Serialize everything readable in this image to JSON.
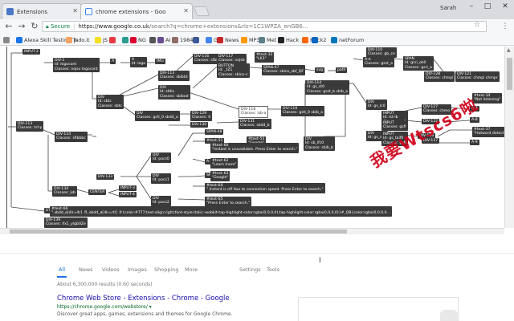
{
  "tabs": [
    {
      "title": "Extensions",
      "active": false,
      "favicon_color": "#4a78c4"
    },
    {
      "title": "chrome extensions - Goo",
      "active": true,
      "favicon_color": "#4285f4"
    }
  ],
  "profile_name": "Sarah",
  "window_controls": [
    "–",
    "□",
    "✕"
  ],
  "omnibox": {
    "secure_label": "Secure",
    "url_host": "https://www.google.co.uk",
    "url_rest": "/search?q=chrome+extensions&rlz=1C1WPZA_enGB6..."
  },
  "bookmarks": [
    {
      "label": "Alexa Skill Testing To",
      "color": "#1a73e8"
    },
    {
      "label": "jsdo.it",
      "color": "#f4a261"
    },
    {
      "label": "JS",
      "color": "#f7df1e"
    },
    {
      "label": "",
      "color": "#e63946"
    },
    {
      "label": "",
      "color": "#2a9d8f"
    },
    {
      "label": "NG",
      "color": "#dd0031"
    },
    {
      "label": "",
      "color": "#555555"
    },
    {
      "label": "AI",
      "color": "#6a4c93"
    },
    {
      "label": "1984",
      "color": "#8d6e63"
    },
    {
      "label": "",
      "color": "#3b5998"
    },
    {
      "label": "G",
      "color": "#4285f4"
    },
    {
      "label": "News",
      "color": "#c62828"
    },
    {
      "label": "MP3",
      "color": "#ff9800"
    },
    {
      "label": "Met",
      "color": "#607d8b"
    },
    {
      "label": "Hack",
      "color": "#222222"
    },
    {
      "label": "Hack2",
      "color": "#ff6600"
    },
    {
      "label": "",
      "color": "#0a66c2"
    },
    {
      "label": "netForum",
      "color": "#0277bd"
    }
  ],
  "tree_nodes": [
    {
      "text": "INPUT-2"
    },
    {
      "text": "DIV-1\nId: logocont\nClasses: nojsv logocont"
    },
    {
      "text": "A"
    },
    {
      "text": "A\nId: logo"
    },
    {
      "text": "IMG"
    },
    {
      "text": "DIV-113\nClasses: sbibtd"
    },
    {
      "text": "DIV-116\nClasses: sfbiu"
    },
    {
      "text": "DIV-117\nClasses: nojsb"
    },
    {
      "text": "#text-33\n\"LK3\""
    },
    {
      "text": "BUTTON\nId: _tZ1\nClasses: sbico-c"
    },
    {
      "text": "SPAN-47\nClasses: sbico_sbf_QF"
    },
    {
      "text": "svg"
    },
    {
      "text": "path"
    },
    {
      "text": "DIV-114\nId: gs_st0\nClasses: gsst_b sbib_a"
    },
    {
      "text": "A-6\nClasses: gsst_a"
    },
    {
      "text": "DIV-110\nClasses: gb_ce"
    },
    {
      "text": "SPAN\nId: gsri_ok0\nClasses: gsri_a"
    },
    {
      "text": "DIV-128\nClasses: chmpl"
    },
    {
      "text": "DIV-121\nClasses: chmpl chmpr"
    },
    {
      "text": "DIV\nId: sbtc\nClasses: sbtc"
    },
    {
      "text": "DIV\nId: sfdiv\nClasses: sbibod"
    },
    {
      "text": "DIV-118\nClasses: lsb-a"
    },
    {
      "text": "DIV-119\nClasses: gstl_0 sbib_a"
    },
    {
      "text": "DIV\nClasses: gstl_0 sbdd_a"
    },
    {
      "text": "DIV-129\nClasses: tl"
    },
    {
      "text": "DIV-130"
    },
    {
      "text": "DIV-131\nClasses: sbdd_b"
    },
    {
      "text": "DIV-127\nClasses: chmo"
    },
    {
      "text": "DIV-122"
    },
    {
      "text": "#text-34\n\"Not listening\""
    },
    {
      "text": "DIV-113\nClasses: tsf-p"
    },
    {
      "text": "DIV-114\nClasses: sfibbbc"
    },
    {
      "text": "DIV\nId: sb_ifc0\nClasses: sbib_b"
    },
    {
      "text": "DIV\nId: gs_lc0"
    },
    {
      "text": "INPUT\nId: lst-ib\nClasses: gsfi"
    },
    {
      "text": "INPUT\nClasses: gsfi"
    },
    {
      "text": "DIV\nId: gs_sc0"
    },
    {
      "text": "INPUT\nId: gs_taif0\nClasses: gsfi"
    },
    {
      "text": "DIV-126"
    },
    {
      "text": "DIV-137"
    },
    {
      "text": "#text-37\n\"Hotword detection is off.\""
    },
    {
      "text": "A-7"
    },
    {
      "text": "A-8"
    },
    {
      "text": "A-9"
    },
    {
      "text": "SPAN-48"
    },
    {
      "text": "#text-51"
    },
    {
      "text": "#text-55\n\"Google\""
    },
    {
      "text": "#text-60\n\"Instant is unavailable. Press Enter to search.\""
    },
    {
      "text": "A-10"
    },
    {
      "text": "#text-62\n\"Learn more\""
    },
    {
      "text": "SPAN-50"
    },
    {
      "text": "#text-63\n\"Google\""
    },
    {
      "text": "#text-64\n\" Instant is off due to connection speed. Press Enter to search.\""
    },
    {
      "text": "DIV\nId: pocs0"
    },
    {
      "text": "DIV\nId: pocs1"
    },
    {
      "text": "DIV\nId: pocs2"
    },
    {
      "text": "#text-65\n\"Press Enter to search.\""
    },
    {
      "text": "DIV-133"
    },
    {
      "text": "DIV-134\nClasses: jsb"
    },
    {
      "text": "CENTER"
    },
    {
      "text": "INPUT-3"
    },
    {
      "text": "INPUT-4"
    },
    {
      "text": "STYLE-7"
    },
    {
      "text": "#text-66\n\".sbdd_a[dir=ltr] .fl,.sbdd_a[dir=rtl] .fr{color:#777;text-align:right;font-style:italic;-webkit-tap-highlight-color:rgba(0,0,0,0);tap-highlight-color:rgba(0,0,0,0)}#_QB{color:rgba(0,0,0,0..."
    },
    {
      "text": "DIV-139\nClasses: ifx1_ylgb0Ze"
    }
  ],
  "watermark_text": "我要Wtscs6啦",
  "watermark_color": "#d0021b",
  "serp": {
    "tabs": [
      "All",
      "News",
      "Videos",
      "Images",
      "Shopping",
      "More",
      "Settings",
      "Tools"
    ],
    "results_count": "About 6,300,000 results (0.60 seconds)",
    "result_title": "Chrome Web Store - Extensions - Chrome - Google",
    "result_url": "https://chrome.google.com/webstore/ ▾",
    "result_snippet": "Discover great apps, games, extensions and themes for Google Chrome."
  },
  "accent_color": "#1a73e8"
}
